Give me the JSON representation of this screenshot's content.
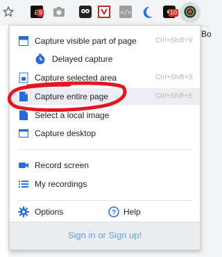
{
  "toolbar": {
    "extensions": [
      {
        "icon": "star-icon"
      },
      {
        "icon": "amazon-icon",
        "badge": "9"
      },
      {
        "icon": "camera-icon"
      },
      {
        "icon": "owl-icon"
      },
      {
        "icon": "shield-icon"
      },
      {
        "icon": "code-icon"
      },
      {
        "icon": "crescent-icon"
      },
      {
        "icon": "game-icon",
        "badge": "10"
      },
      {
        "icon": "screenshot-extension-icon"
      }
    ],
    "cut_text": "Bo"
  },
  "menu": {
    "items": [
      {
        "label": "Capture visible part of page",
        "shortcut": "Ctrl+Shift+V",
        "icon": "visible-page-icon"
      },
      {
        "label": "Delayed capture",
        "icon": "timer-icon"
      },
      {
        "label": "Capture selected area",
        "shortcut": "Ctrl+Shift+S",
        "icon": "selected-area-icon"
      },
      {
        "label": "Capture entire page",
        "shortcut": "Ctrl+Shift+E",
        "icon": "entire-page-icon"
      },
      {
        "label": "Select a local image",
        "icon": "local-image-icon"
      },
      {
        "label": "Capture desktop",
        "icon": "desktop-icon"
      },
      {
        "label": "Record screen",
        "icon": "video-camera-icon"
      },
      {
        "label": "My recordings",
        "icon": "list-icon"
      },
      {
        "label": "Options",
        "icon": "gear-icon"
      },
      {
        "label": "Help",
        "icon": "help-icon"
      }
    ],
    "signin": "Sign in or Sign up!"
  },
  "colors": {
    "accent": "#2b6bd6",
    "annotation": "#e8141e",
    "signin": "#5fa1de"
  }
}
